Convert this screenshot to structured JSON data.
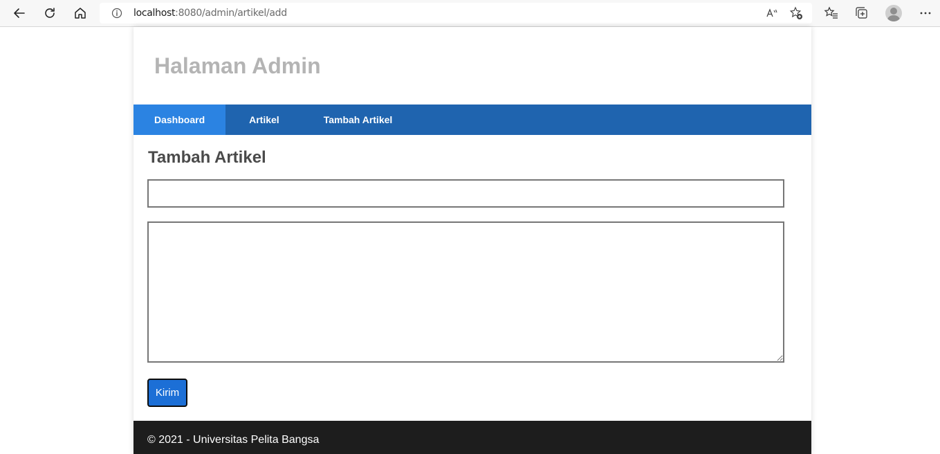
{
  "browser": {
    "url_host": "localhost",
    "url_path": ":8080/admin/artikel/add"
  },
  "header": {
    "title": "Halaman Admin"
  },
  "nav": {
    "items": [
      {
        "label": "Dashboard",
        "active": true
      },
      {
        "label": "Artikel",
        "active": false
      },
      {
        "label": "Tambah Artikel",
        "active": false
      }
    ]
  },
  "form": {
    "heading": "Tambah Artikel",
    "title_value": "",
    "body_value": "",
    "submit_label": "Kirim"
  },
  "footer": {
    "text": "© 2021 - Universitas Pelita Bangsa"
  },
  "colors": {
    "nav_bg": "#1f64af",
    "nav_active": "#2b83e2",
    "button_bg": "#1c6fd6",
    "footer_bg": "#1d1d1d",
    "title_color": "#b4b4b4"
  }
}
